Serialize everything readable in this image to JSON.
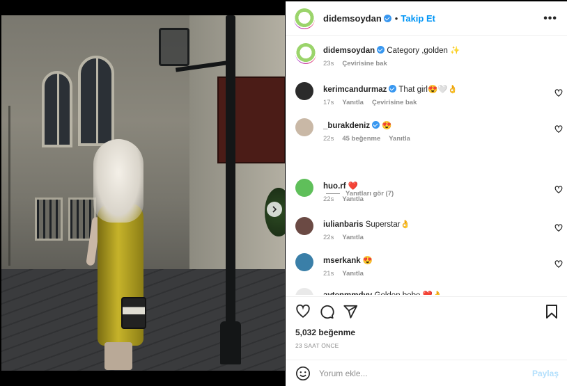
{
  "post": {
    "username": "didemsoydan",
    "follow_label": "Takip Et",
    "bullet": "•",
    "more": "•••",
    "caption": {
      "username": "didemsoydan",
      "text": "Category ,golden ✨",
      "time": "23s",
      "translate": "Çevirisine bak"
    },
    "comments": [
      {
        "username": "kerimcandurmaz",
        "text": "That girl😍🤍👌",
        "time": "17s",
        "actions": [
          "Yanıtla",
          "Çevirisine bak"
        ],
        "avatar_color": "#2b2b2b"
      },
      {
        "username": "_burakdeniz",
        "text": "😍",
        "time": "22s",
        "actions": [
          "45 beğenme",
          "Yanıtla"
        ],
        "avatar_color": "#c9b8a6"
      },
      {
        "username": "huo.rf",
        "text": "❤️",
        "time": "22s",
        "actions": [
          "Yanıtla"
        ],
        "avatar_color": "#5fbf5a"
      },
      {
        "username": "iulianbaris",
        "text": "Superstar👌",
        "time": "22s",
        "actions": [
          "Yanıtla"
        ],
        "avatar_color": "#6b4a44"
      },
      {
        "username": "mserkank",
        "text": "😍",
        "time": "21s",
        "actions": [
          "Yanıtla"
        ],
        "avatar_color": "#3a7fa8"
      },
      {
        "username": "aytenmmdvv",
        "text": "Golden bebe ❤️👌",
        "time": "",
        "actions": [],
        "avatar_color": "#e9e9e9"
      }
    ],
    "view_replies": "Yanıtları gör (7)",
    "likes": "5,032 beğenme",
    "timestamp": "23 SAAT ÖNCE",
    "add_comment_placeholder": "Yorum ekle...",
    "post_button": "Paylaş"
  },
  "icons": {
    "like": "heart-icon",
    "comment": "comment-icon",
    "share": "send-icon",
    "save": "bookmark-icon",
    "emoji": "smiley-icon",
    "next": "chevron-right-icon"
  },
  "carousel": {
    "total": 6,
    "active": 1
  },
  "colors": {
    "accent": "#0095f6",
    "verified": "#3897f0",
    "muted": "#8e8e8e"
  }
}
